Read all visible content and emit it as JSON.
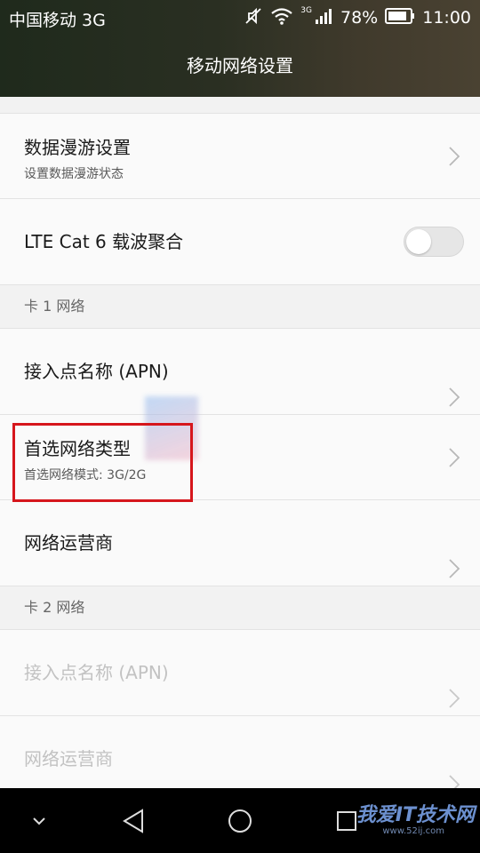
{
  "status_bar": {
    "carrier": "中国移动 3G",
    "network_label": "3G",
    "battery": "78%",
    "time": "11:00"
  },
  "header": {
    "title": "移动网络设置"
  },
  "settings": {
    "roaming": {
      "title": "数据漫游设置",
      "subtitle": "设置数据漫游状态"
    },
    "lte": {
      "title": "LTE Cat 6 载波聚合",
      "toggle_on": false
    },
    "sim1": {
      "section_label": "卡 1 网络",
      "apn": {
        "title": "接入点名称 (APN)"
      },
      "network_type": {
        "title": "首选网络类型",
        "subtitle": "首选网络模式: 3G/2G"
      },
      "operator": {
        "title": "网络运营商"
      }
    },
    "sim2": {
      "section_label": "卡 2 网络",
      "apn": {
        "title": "接入点名称 (APN)",
        "disabled": true
      },
      "operator": {
        "title": "网络运营商",
        "disabled": true
      }
    }
  },
  "watermark": {
    "text": "我爱IT技术网",
    "url": "www.52ij.com"
  },
  "colors": {
    "highlight_border": "#d6161c",
    "disabled_text": "#c2c2c2"
  }
}
